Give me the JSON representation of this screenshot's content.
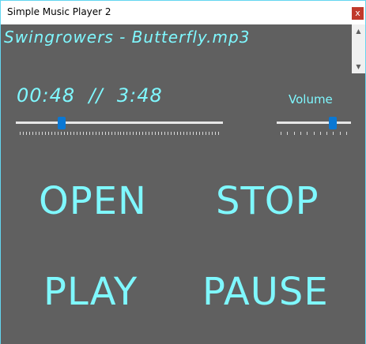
{
  "window": {
    "title": "Simple Music Player 2",
    "close_label": "x"
  },
  "now_playing": {
    "filename": "Swingrowers - Butterfly.mp3"
  },
  "time": {
    "display": "00:48  //  3:48",
    "elapsed": "00:48",
    "total": "3:48",
    "position_fraction": 0.22
  },
  "volume": {
    "label": "Volume",
    "level_fraction": 0.75
  },
  "buttons": {
    "open": "OPEN",
    "stop": "STOP",
    "play": "PLAY",
    "pause": "PAUSE"
  },
  "colors": {
    "accent": "#7ff8ff",
    "background": "#606060",
    "slider_thumb": "#0a78d4"
  },
  "icons": {
    "scroll_up": "chevron-up-icon",
    "scroll_down": "chevron-down-icon",
    "close": "close-icon"
  }
}
